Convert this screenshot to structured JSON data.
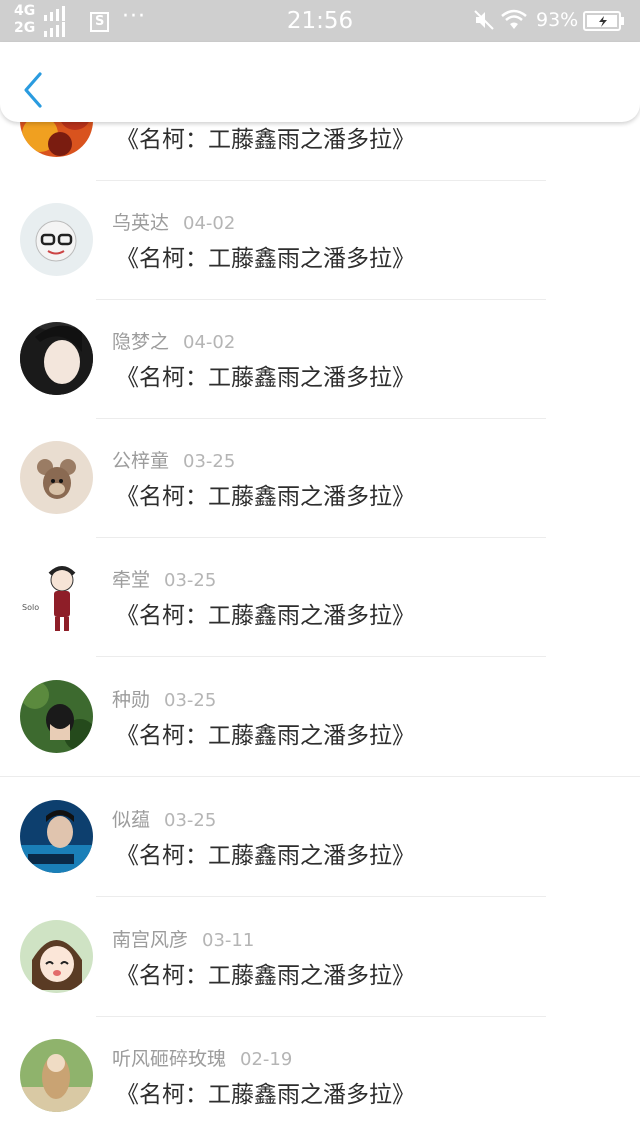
{
  "status_bar": {
    "network_top": "4G",
    "network_bottom": "2G",
    "sim_icon": "S",
    "more": "···",
    "time": "21:56",
    "battery": "93%"
  },
  "nav": {
    "back_icon": "chevron-left"
  },
  "list": {
    "items": [
      {
        "name": "",
        "date": "",
        "title": "《名柯：工藤鑫雨之潘多拉》"
      },
      {
        "name": "乌英达",
        "date": "04-02",
        "title": "《名柯：工藤鑫雨之潘多拉》"
      },
      {
        "name": "隐梦之",
        "date": "04-02",
        "title": "《名柯：工藤鑫雨之潘多拉》"
      },
      {
        "name": "公梓童",
        "date": "03-25",
        "title": "《名柯：工藤鑫雨之潘多拉》"
      },
      {
        "name": "牵堂",
        "date": "03-25",
        "title": "《名柯：工藤鑫雨之潘多拉》"
      },
      {
        "name": "种勋",
        "date": "03-25",
        "title": "《名柯：工藤鑫雨之潘多拉》"
      },
      {
        "name": "似蕴",
        "date": "03-25",
        "title": "《名柯：工藤鑫雨之潘多拉》"
      },
      {
        "name": "南宫风彦",
        "date": "03-11",
        "title": "《名柯：工藤鑫雨之潘多拉》"
      },
      {
        "name": "听风砸碎玫瑰",
        "date": "02-19",
        "title": "《名柯：工藤鑫雨之潘多拉》"
      }
    ]
  },
  "colors": {
    "accent": "#2a9bdf",
    "status_bar_bg": "#cfcfcf",
    "name_text": "#9c9c9c",
    "title_text": "#2e2e2e"
  }
}
